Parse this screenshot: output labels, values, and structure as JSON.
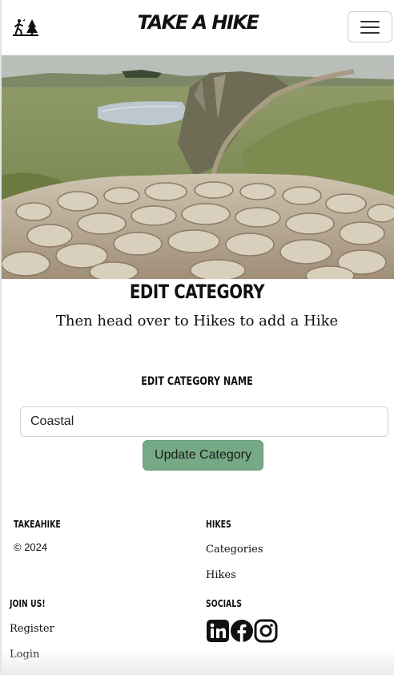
{
  "navbar": {
    "brand": "TAKE A HIKE",
    "logo_icon": "hikers-trees-icon",
    "menu_icon": "hamburger-menu-icon"
  },
  "hero": {
    "image": "hadrians-wall-landscape-photo"
  },
  "main": {
    "title": "EDIT CATEGORY",
    "subtitle": "Then head over to Hikes to add a Hike",
    "field_label": "EDIT CATEGORY NAME",
    "field_value": "Coastal",
    "submit_label": "Update Category"
  },
  "footer": {
    "brand_heading": "TAKEAHIKE",
    "copyright": "© 2024",
    "hikes_heading": "HIKES",
    "hikes_links": [
      "Categories",
      "Hikes"
    ],
    "join_heading": "JOIN US!",
    "join_links": [
      "Register",
      "Login"
    ],
    "socials_heading": "SOCIALS",
    "social_icons": [
      "linkedin-icon",
      "facebook-icon",
      "instagram-icon"
    ]
  },
  "colors": {
    "button_bg": "#76a985",
    "text": "#111111",
    "border": "#cfd3d7"
  }
}
